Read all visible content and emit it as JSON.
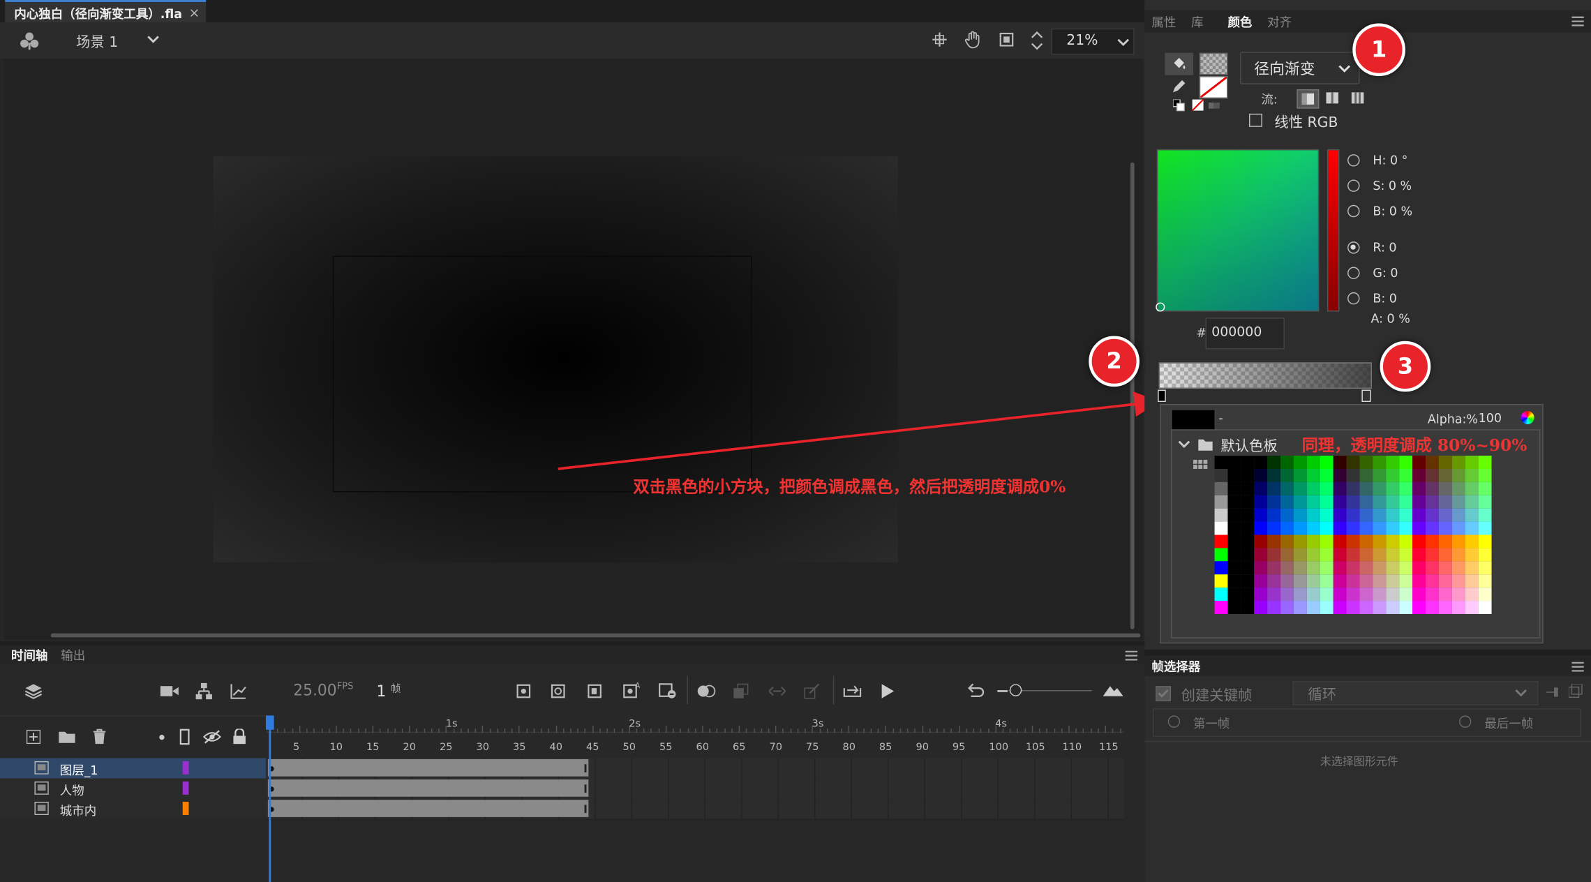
{
  "doc_tab": {
    "title": "内心独白（径向渐变工具）.fla",
    "close": "×"
  },
  "scene": {
    "label": "场景 1"
  },
  "zoom": "21%",
  "right_tabs": [
    "属性",
    "库",
    "颜色",
    "对齐"
  ],
  "color_panel": {
    "fill_type": "径向渐变",
    "flow_label": "流:",
    "linear_rgb": "线性 RGB",
    "hsb": {
      "h": "H: 0 °",
      "s": "S: 0 %",
      "b": "B: 0 %"
    },
    "rgb": {
      "r": "R: 0",
      "g": "G: 0",
      "b": "B: 0"
    },
    "alpha": "A: 0 %",
    "hex_hash": "#",
    "hex": "000000",
    "selected_rgb_channel": "R"
  },
  "swatch_popup": {
    "dash": "-",
    "alpha_label": "Alpha:%",
    "alpha_value": "100",
    "palette_name": "默认色板"
  },
  "annotations": {
    "a1": "1",
    "a2": "2",
    "a3": "3",
    "note2": "双击黑色的小方块，把颜色调成黑色，然后把透明度调成0%",
    "note3": "同理，透明度调成 80%~90%"
  },
  "timeline": {
    "tabs": [
      "时间轴",
      "输出"
    ],
    "fps": "25.00",
    "fps_unit": "FPS",
    "frame": "1",
    "frame_unit": "帧",
    "seconds": [
      "1s",
      "2s",
      "3s",
      "4s"
    ],
    "frame_ticks": [
      "5",
      "10",
      "15",
      "20",
      "25",
      "30",
      "35",
      "40",
      "45",
      "50",
      "55",
      "60",
      "65",
      "70",
      "75",
      "80",
      "85",
      "90",
      "95",
      "100",
      "105",
      "110",
      "115"
    ],
    "layers": [
      {
        "name": "图层_1",
        "color": "#9b30d0",
        "selected": true
      },
      {
        "name": "人物",
        "color": "#9b30d0",
        "selected": false
      },
      {
        "name": "城市内",
        "color": "#ff7f00",
        "selected": false
      }
    ]
  },
  "frame_picker": {
    "title": "帧选择器",
    "create_keyframe": "创建关键帧",
    "loop": "循环",
    "first_frame": "第一帧",
    "last_frame": "最后一帧",
    "empty": "未选择图形元件"
  }
}
